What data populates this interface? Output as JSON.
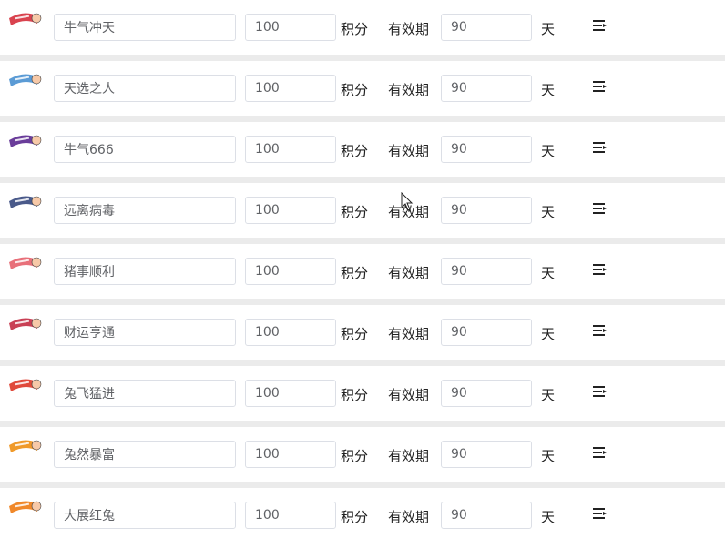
{
  "labels": {
    "points_unit": "积分",
    "validity": "有效期",
    "days_unit": "天"
  },
  "rows": [
    {
      "name": "牛气冲天",
      "points": "100",
      "days": "90",
      "badge_color": "#d9434f",
      "badge_icon": "badge-ox-icon"
    },
    {
      "name": "天选之人",
      "points": "100",
      "days": "90",
      "badge_color": "#5b9bd5",
      "badge_icon": "badge-chosen-icon"
    },
    {
      "name": "牛气666",
      "points": "100",
      "days": "90",
      "badge_color": "#6a3d9a",
      "badge_icon": "badge-ox666-icon"
    },
    {
      "name": "远离病毒",
      "points": "100",
      "days": "90",
      "badge_color": "#4a5a8a",
      "badge_icon": "badge-virus-icon"
    },
    {
      "name": "猪事顺利",
      "points": "100",
      "days": "90",
      "badge_color": "#e8707a",
      "badge_icon": "badge-pig-icon"
    },
    {
      "name": "财运亨通",
      "points": "100",
      "days": "90",
      "badge_color": "#c94055",
      "badge_icon": "badge-wealth-icon"
    },
    {
      "name": "兔飞猛进",
      "points": "100",
      "days": "90",
      "badge_color": "#e04a3c",
      "badge_icon": "badge-rabbit-icon"
    },
    {
      "name": "兔然暴富",
      "points": "100",
      "days": "90",
      "badge_color": "#f09a2a",
      "badge_icon": "badge-rich-icon"
    },
    {
      "name": "大展红兔",
      "points": "100",
      "days": "90",
      "badge_color": "#f0882a",
      "badge_icon": "badge-red-rabbit-icon"
    }
  ]
}
